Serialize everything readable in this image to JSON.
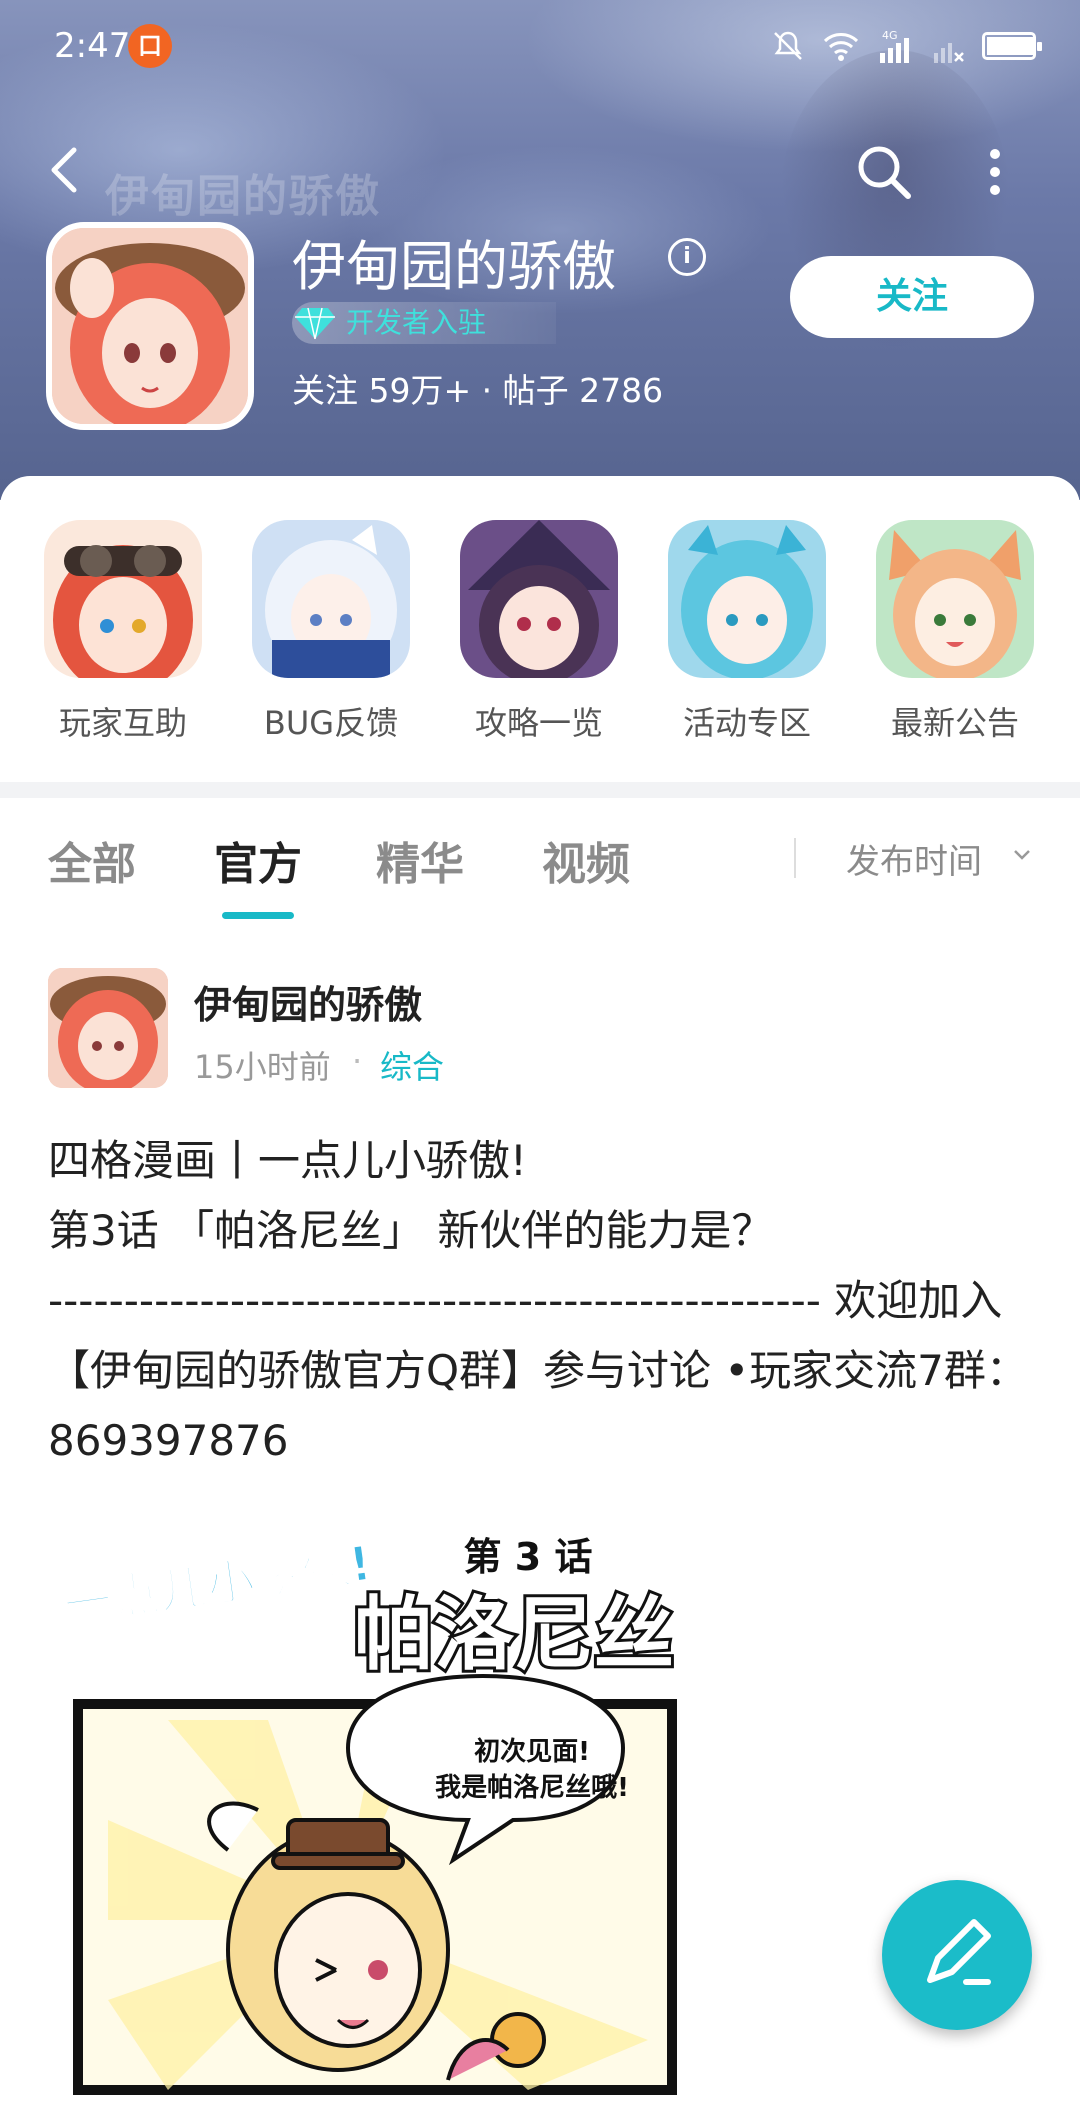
{
  "status_bar": {
    "time": "2:47",
    "notif_glyph": "口",
    "network": "4G"
  },
  "header": {
    "watermark": "伊甸园的骄傲",
    "title": "伊甸园的骄傲",
    "info_glyph": "i",
    "badge": "开发者入驻",
    "stats": "关注 59万+ · 帖子 2786",
    "follow_label": "关注"
  },
  "quick_links": [
    {
      "label": "玩家互助",
      "icon": "game-avatar-goggles-girl"
    },
    {
      "label": "BUG反馈",
      "icon": "game-avatar-white-hair-girl"
    },
    {
      "label": "攻略一览",
      "icon": "game-avatar-witch-girl"
    },
    {
      "label": "活动专区",
      "icon": "game-avatar-blue-hair-girl"
    },
    {
      "label": "最新公告",
      "icon": "game-avatar-fox-ear-girl"
    }
  ],
  "tabs": [
    {
      "label": "全部",
      "active": false
    },
    {
      "label": "官方",
      "active": true
    },
    {
      "label": "精华",
      "active": false
    },
    {
      "label": "视频",
      "active": false
    }
  ],
  "sort_label": "发布时间",
  "post": {
    "author": "伊甸园的骄傲",
    "time": "15小时前",
    "category": "综合",
    "lines": [
      "四格漫画丨一点儿小骄傲!",
      "第3话 「帕洛尼丝」 新伙伴的能力是？",
      "--------------------------------------------------- 欢迎加入【伊甸园的骄傲官方Q群】参与讨论 •玩家交流7群：869397876"
    ],
    "comic": {
      "series_title": "一点儿小骄傲!",
      "episode": "第 3 话",
      "character": "帕洛尼丝",
      "speech_line1": "初次见面!",
      "speech_line2": "我是帕洛尼丝哦!"
    }
  },
  "colors": {
    "accent": "#18b9c7",
    "header_bg": "#6b79a8",
    "fab": "#1bbcc9"
  }
}
